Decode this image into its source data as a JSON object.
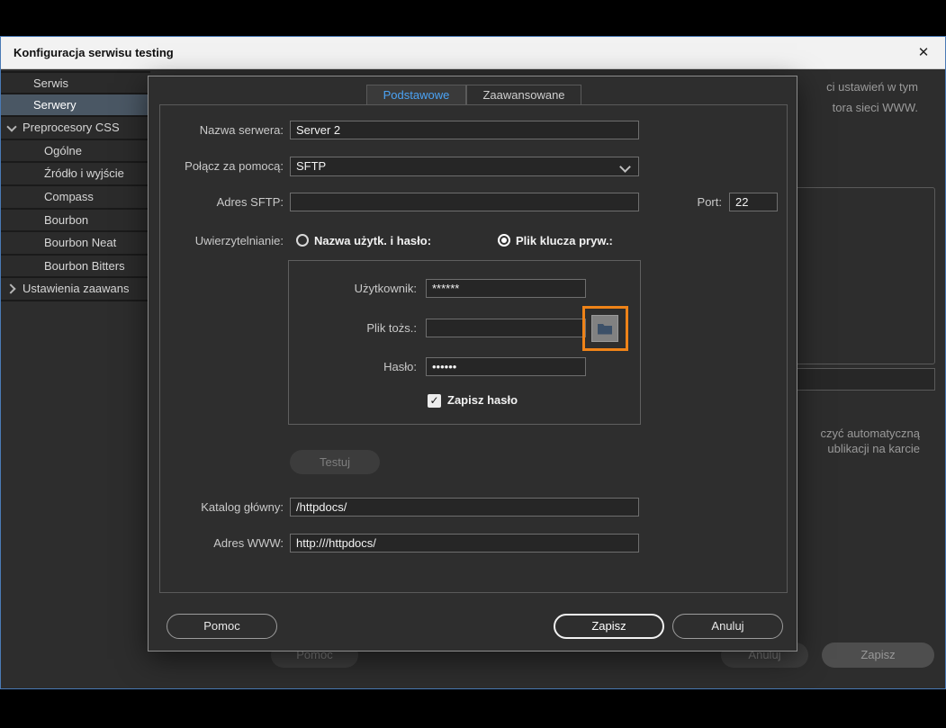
{
  "window": {
    "title": "Konfiguracja serwisu testing"
  },
  "icons": {
    "close_glyph": "✕",
    "check_glyph": "✓"
  },
  "sidebar": {
    "items": [
      {
        "label": "Serwis"
      },
      {
        "label": "Serwery"
      },
      {
        "label": "Preprocesory CSS"
      },
      {
        "label": "Ogólne"
      },
      {
        "label": "Źródło i wyjście"
      },
      {
        "label": "Compass"
      },
      {
        "label": "Bourbon"
      },
      {
        "label": "Bourbon Neat"
      },
      {
        "label": "Bourbon Bitters"
      },
      {
        "label": "Ustawienia zaawans"
      }
    ]
  },
  "background": {
    "line1": "ci ustawień w tym",
    "line2": "tora sieci WWW.",
    "line3": "czyć automatyczną",
    "line4": "ublikacji na karcie",
    "help": "Pomoc",
    "cancel": "Anuluj",
    "save": "Zapisz"
  },
  "dialog": {
    "tabs": [
      {
        "label": "Podstawowe"
      },
      {
        "label": "Zaawansowane"
      }
    ],
    "server_name_label": "Nazwa serwera:",
    "server_name_value": "Server 2",
    "connect_label": "Połącz za pomocą:",
    "connect_value": "SFTP",
    "address_label": "Adres SFTP:",
    "address_value": "",
    "port_label": "Port:",
    "port_value": "22",
    "auth_label": "Uwierzytelnianie:",
    "auth_option1": "Nazwa użytk. i hasło:",
    "auth_option2": "Plik klucza pryw.:",
    "username_label": "Użytkownik:",
    "username_value": "******",
    "identity_label": "Plik tożs.:",
    "identity_value": "",
    "password_label": "Hasło:",
    "password_value": "••••••",
    "save_password_label": "Zapisz hasło",
    "test_button": "Testuj",
    "root_label": "Katalog główny:",
    "root_value": "/httpdocs/",
    "url_label": "Adres WWW:",
    "url_value": "http:///httpdocs/",
    "help_button": "Pomoc",
    "save_button": "Zapisz",
    "cancel_button": "Anuluj"
  },
  "colors": {
    "accent_blue": "#4ba3f5",
    "highlight_orange": "#ef8318",
    "selected_row": "#4a5764"
  }
}
